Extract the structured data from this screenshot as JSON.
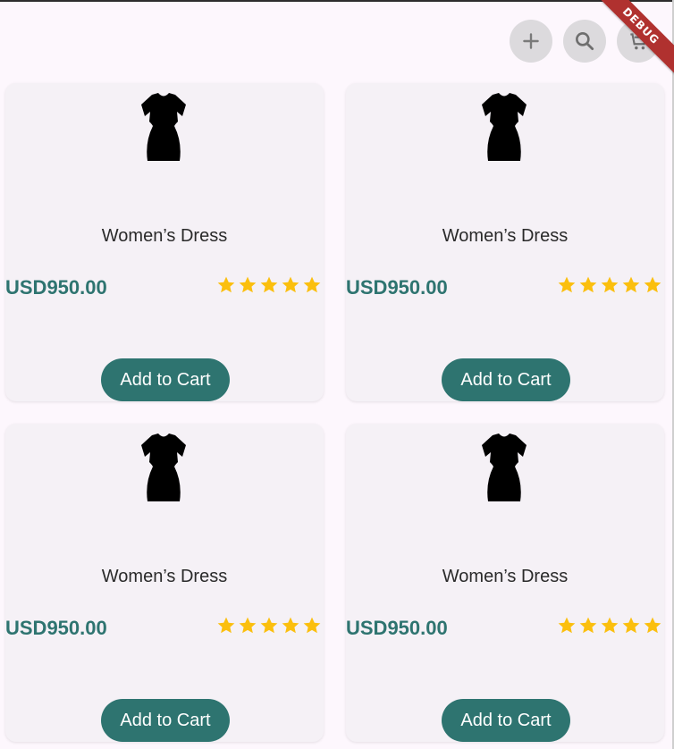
{
  "appbar": {
    "actions": [
      {
        "icon": "plus-icon"
      },
      {
        "icon": "search-icon"
      },
      {
        "icon": "cart-icon"
      }
    ],
    "debug_banner": "DEBUG"
  },
  "products": [
    {
      "title": "Women’s Dress",
      "price": "USD950.00",
      "rating": 5,
      "button": "Add to Cart"
    },
    {
      "title": "Women’s Dress",
      "price": "USD950.00",
      "rating": 5,
      "button": "Add to Cart"
    },
    {
      "title": "Women’s Dress",
      "price": "USD950.00",
      "rating": 5,
      "button": "Add to Cart"
    },
    {
      "title": "Women’s Dress",
      "price": "USD950.00",
      "rating": 5,
      "button": "Add to Cart"
    }
  ],
  "colors": {
    "accent": "#2e7470",
    "star": "#fbbf0e",
    "card": "#f5f1f6",
    "background": "#fdf7fd"
  }
}
